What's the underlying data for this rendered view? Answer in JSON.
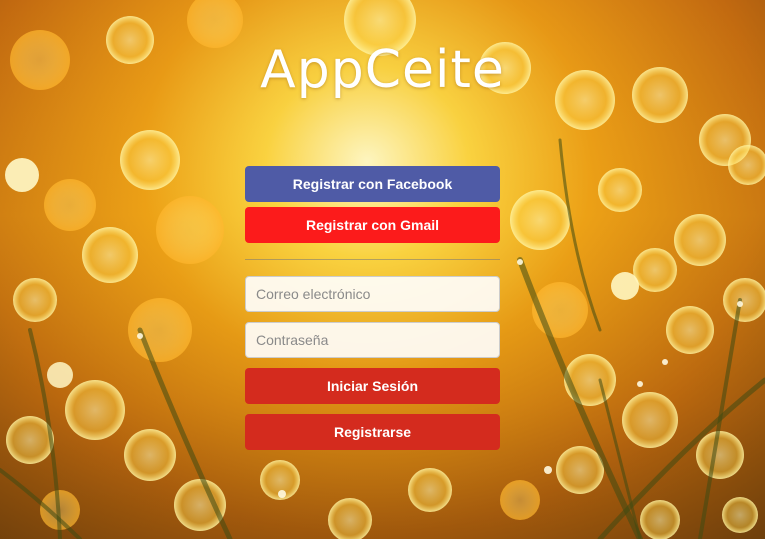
{
  "app": {
    "title": "AppCeite"
  },
  "social": {
    "facebook_label": "Registrar con Facebook",
    "gmail_label": "Registrar con Gmail"
  },
  "login_form": {
    "email_placeholder": "Correo electrónico",
    "email_value": "",
    "password_placeholder": "Contraseña",
    "password_value": "",
    "login_label": "Iniciar Sesión",
    "register_label": "Registrarse"
  },
  "colors": {
    "facebook": "#4f5ba6",
    "gmail": "#fc1b1b",
    "primary": "#d42b1e"
  },
  "background": {
    "description_icon": "golden-bokeh-grass-photo"
  }
}
